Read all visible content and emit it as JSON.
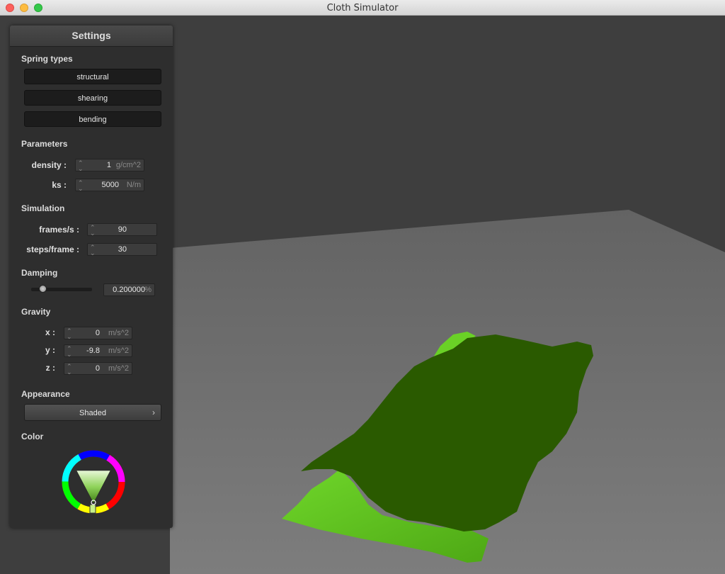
{
  "window": {
    "title": "Cloth Simulator"
  },
  "panel": {
    "title": "Settings",
    "spring_types": {
      "heading": "Spring types",
      "buttons": [
        "structural",
        "shearing",
        "bending"
      ]
    },
    "parameters": {
      "heading": "Parameters",
      "density": {
        "label": "density :",
        "value": "1",
        "unit": "g/cm^2"
      },
      "ks": {
        "label": "ks :",
        "value": "5000",
        "unit": "N/m"
      }
    },
    "simulation": {
      "heading": "Simulation",
      "frames": {
        "label": "frames/s :",
        "value": "90"
      },
      "steps": {
        "label": "steps/frame :",
        "value": "30"
      }
    },
    "damping": {
      "heading": "Damping",
      "value": "0.200000",
      "unit": "%",
      "slider_fraction": 0.2
    },
    "gravity": {
      "heading": "Gravity",
      "x": {
        "label": "x :",
        "value": "0",
        "unit": "m/s^2"
      },
      "y": {
        "label": "y :",
        "value": "-9.8",
        "unit": "m/s^2"
      },
      "z": {
        "label": "z :",
        "value": "0",
        "unit": "m/s^2"
      }
    },
    "appearance": {
      "heading": "Appearance",
      "selected": "Shaded"
    },
    "color": {
      "heading": "Color",
      "current": "#5ec21e"
    }
  },
  "scene": {
    "cloth_dark": "#2a5a00",
    "cloth_light": "#5ec21e",
    "floor": "#6f6f6f",
    "background": "#3e3e3e"
  }
}
